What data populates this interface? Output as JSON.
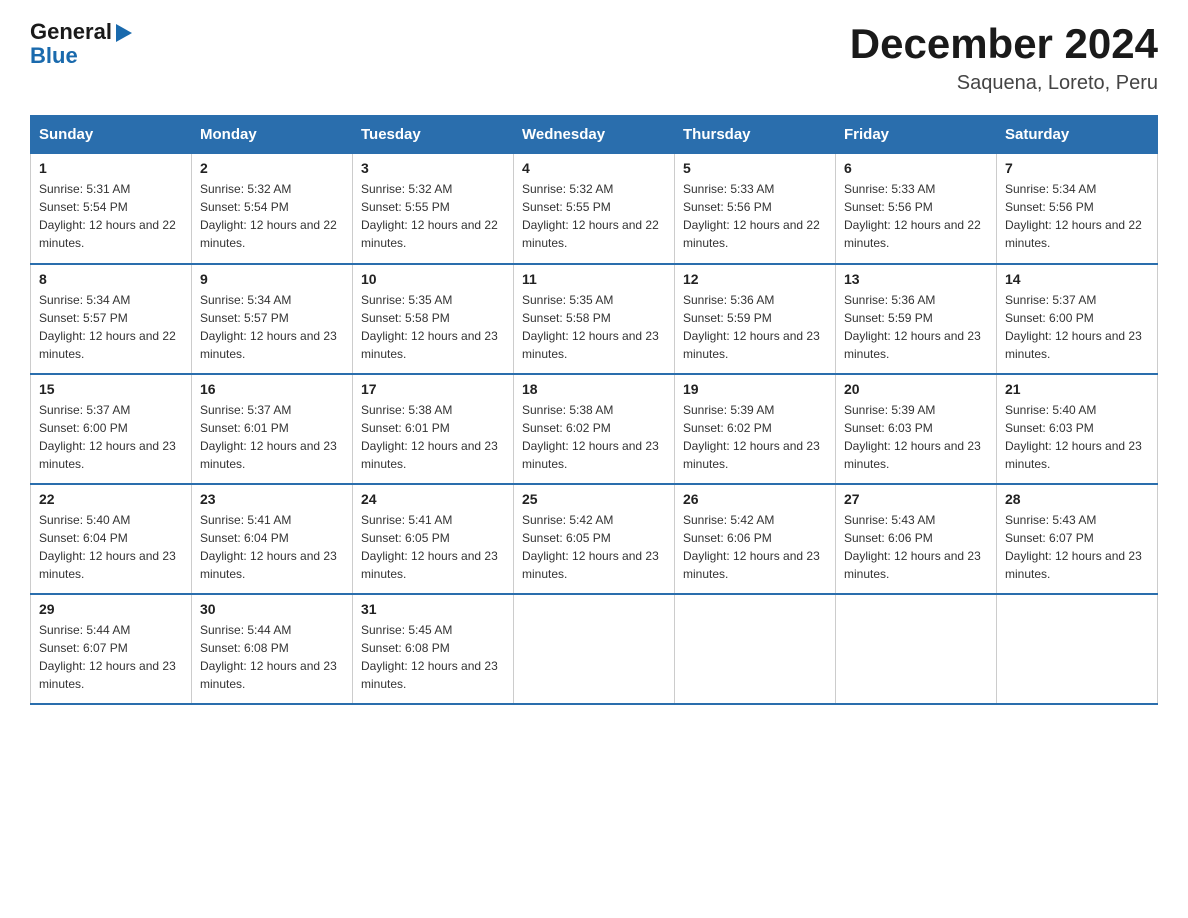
{
  "header": {
    "logo_general": "General",
    "logo_blue": "Blue",
    "month_title": "December 2024",
    "location": "Saquena, Loreto, Peru"
  },
  "days_of_week": [
    "Sunday",
    "Monday",
    "Tuesday",
    "Wednesday",
    "Thursday",
    "Friday",
    "Saturday"
  ],
  "weeks": [
    [
      {
        "day": 1,
        "sunrise": "5:31 AM",
        "sunset": "5:54 PM",
        "daylight": "12 hours and 22 minutes."
      },
      {
        "day": 2,
        "sunrise": "5:32 AM",
        "sunset": "5:54 PM",
        "daylight": "12 hours and 22 minutes."
      },
      {
        "day": 3,
        "sunrise": "5:32 AM",
        "sunset": "5:55 PM",
        "daylight": "12 hours and 22 minutes."
      },
      {
        "day": 4,
        "sunrise": "5:32 AM",
        "sunset": "5:55 PM",
        "daylight": "12 hours and 22 minutes."
      },
      {
        "day": 5,
        "sunrise": "5:33 AM",
        "sunset": "5:56 PM",
        "daylight": "12 hours and 22 minutes."
      },
      {
        "day": 6,
        "sunrise": "5:33 AM",
        "sunset": "5:56 PM",
        "daylight": "12 hours and 22 minutes."
      },
      {
        "day": 7,
        "sunrise": "5:34 AM",
        "sunset": "5:56 PM",
        "daylight": "12 hours and 22 minutes."
      }
    ],
    [
      {
        "day": 8,
        "sunrise": "5:34 AM",
        "sunset": "5:57 PM",
        "daylight": "12 hours and 22 minutes."
      },
      {
        "day": 9,
        "sunrise": "5:34 AM",
        "sunset": "5:57 PM",
        "daylight": "12 hours and 23 minutes."
      },
      {
        "day": 10,
        "sunrise": "5:35 AM",
        "sunset": "5:58 PM",
        "daylight": "12 hours and 23 minutes."
      },
      {
        "day": 11,
        "sunrise": "5:35 AM",
        "sunset": "5:58 PM",
        "daylight": "12 hours and 23 minutes."
      },
      {
        "day": 12,
        "sunrise": "5:36 AM",
        "sunset": "5:59 PM",
        "daylight": "12 hours and 23 minutes."
      },
      {
        "day": 13,
        "sunrise": "5:36 AM",
        "sunset": "5:59 PM",
        "daylight": "12 hours and 23 minutes."
      },
      {
        "day": 14,
        "sunrise": "5:37 AM",
        "sunset": "6:00 PM",
        "daylight": "12 hours and 23 minutes."
      }
    ],
    [
      {
        "day": 15,
        "sunrise": "5:37 AM",
        "sunset": "6:00 PM",
        "daylight": "12 hours and 23 minutes."
      },
      {
        "day": 16,
        "sunrise": "5:37 AM",
        "sunset": "6:01 PM",
        "daylight": "12 hours and 23 minutes."
      },
      {
        "day": 17,
        "sunrise": "5:38 AM",
        "sunset": "6:01 PM",
        "daylight": "12 hours and 23 minutes."
      },
      {
        "day": 18,
        "sunrise": "5:38 AM",
        "sunset": "6:02 PM",
        "daylight": "12 hours and 23 minutes."
      },
      {
        "day": 19,
        "sunrise": "5:39 AM",
        "sunset": "6:02 PM",
        "daylight": "12 hours and 23 minutes."
      },
      {
        "day": 20,
        "sunrise": "5:39 AM",
        "sunset": "6:03 PM",
        "daylight": "12 hours and 23 minutes."
      },
      {
        "day": 21,
        "sunrise": "5:40 AM",
        "sunset": "6:03 PM",
        "daylight": "12 hours and 23 minutes."
      }
    ],
    [
      {
        "day": 22,
        "sunrise": "5:40 AM",
        "sunset": "6:04 PM",
        "daylight": "12 hours and 23 minutes."
      },
      {
        "day": 23,
        "sunrise": "5:41 AM",
        "sunset": "6:04 PM",
        "daylight": "12 hours and 23 minutes."
      },
      {
        "day": 24,
        "sunrise": "5:41 AM",
        "sunset": "6:05 PM",
        "daylight": "12 hours and 23 minutes."
      },
      {
        "day": 25,
        "sunrise": "5:42 AM",
        "sunset": "6:05 PM",
        "daylight": "12 hours and 23 minutes."
      },
      {
        "day": 26,
        "sunrise": "5:42 AM",
        "sunset": "6:06 PM",
        "daylight": "12 hours and 23 minutes."
      },
      {
        "day": 27,
        "sunrise": "5:43 AM",
        "sunset": "6:06 PM",
        "daylight": "12 hours and 23 minutes."
      },
      {
        "day": 28,
        "sunrise": "5:43 AM",
        "sunset": "6:07 PM",
        "daylight": "12 hours and 23 minutes."
      }
    ],
    [
      {
        "day": 29,
        "sunrise": "5:44 AM",
        "sunset": "6:07 PM",
        "daylight": "12 hours and 23 minutes."
      },
      {
        "day": 30,
        "sunrise": "5:44 AM",
        "sunset": "6:08 PM",
        "daylight": "12 hours and 23 minutes."
      },
      {
        "day": 31,
        "sunrise": "5:45 AM",
        "sunset": "6:08 PM",
        "daylight": "12 hours and 23 minutes."
      },
      null,
      null,
      null,
      null
    ]
  ]
}
